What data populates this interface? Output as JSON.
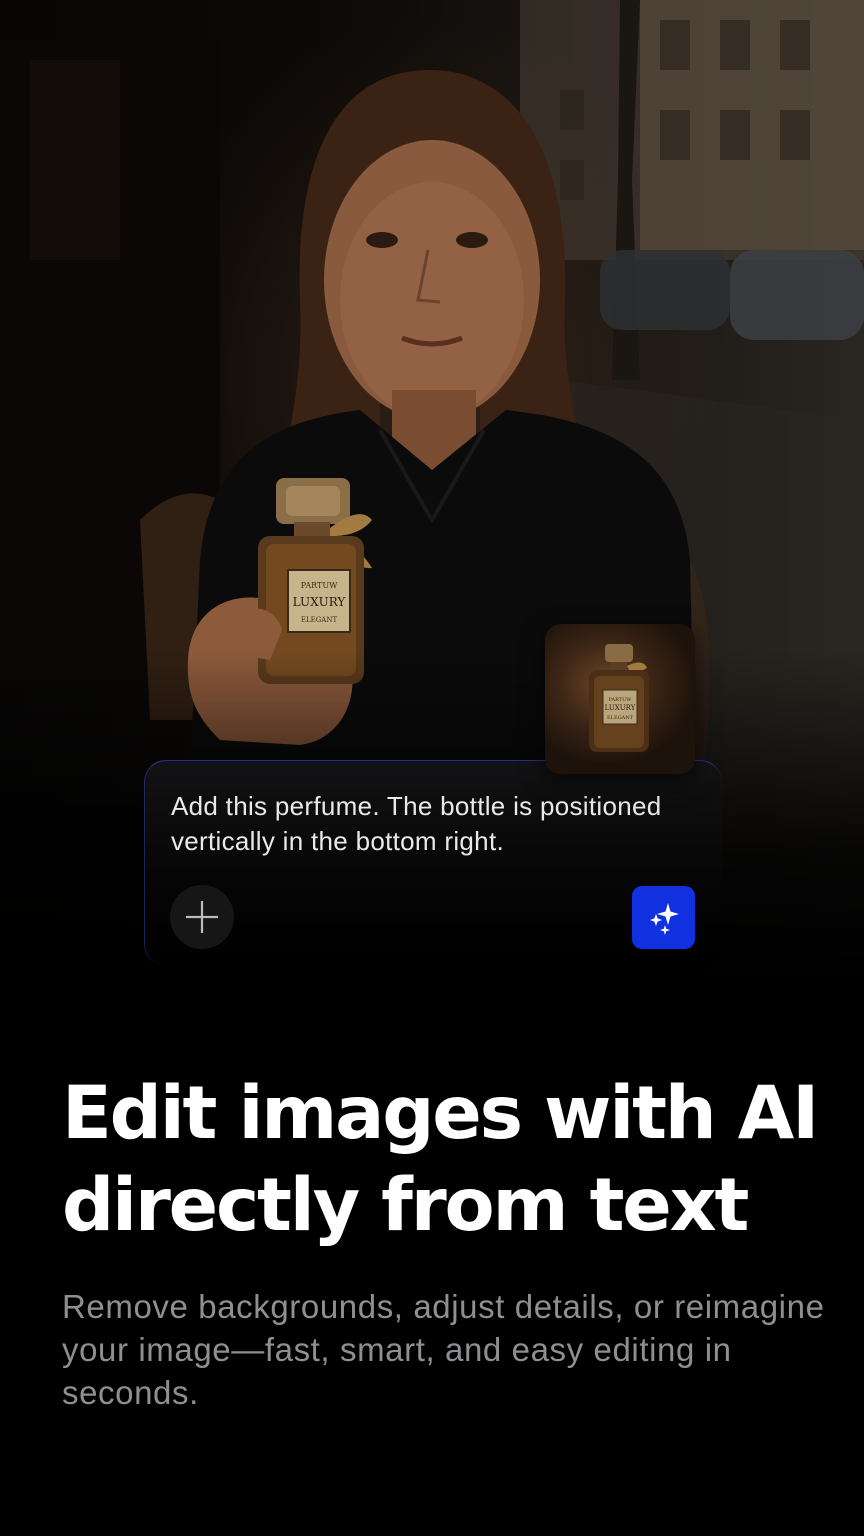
{
  "prompt": {
    "text": "Add this perfume. The bottle is positioned vertically in the bottom right.",
    "add_icon": "plus-icon",
    "generate_icon": "sparkles-icon"
  },
  "bottle": {
    "brand_top": "PARTUW",
    "brand_main": "LUXURY",
    "brand_bottom": "ELEGANT"
  },
  "headline": "Edit images with AI directly from text",
  "subtext": "Remove backgrounds, adjust details, or reimagine your image—fast, smart, and easy editing in seconds.",
  "colors": {
    "accent": "#1130E0",
    "background": "#000000",
    "subtext": "#8F8F92"
  }
}
